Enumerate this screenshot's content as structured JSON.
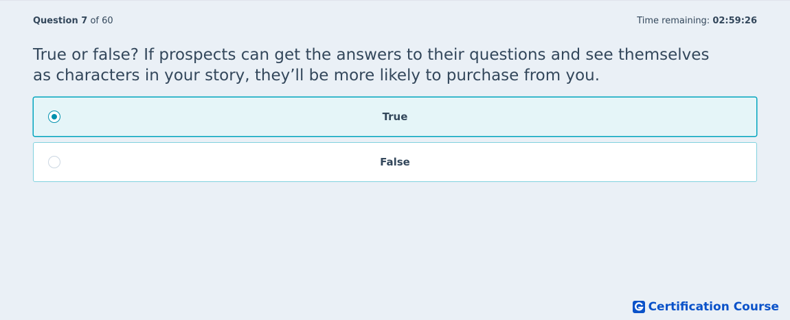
{
  "header": {
    "question_label": "Question 7",
    "question_of": "of 60",
    "time_label": "Time remaining:",
    "time_value": "02:59:26"
  },
  "question": {
    "text": "True or false? If prospects can get the answers to their questions and see themselves as characters in your story, they’ll be more likely to purchase from you."
  },
  "options": [
    {
      "label": "True",
      "selected": true
    },
    {
      "label": "False",
      "selected": false
    }
  ],
  "brand": {
    "text": "Certification Course",
    "logo_letter": "G"
  },
  "colors": {
    "background": "#eaf0f6",
    "accent": "#00a4bd",
    "radio_selected": "#0091ae",
    "brand": "#0a52c9"
  }
}
